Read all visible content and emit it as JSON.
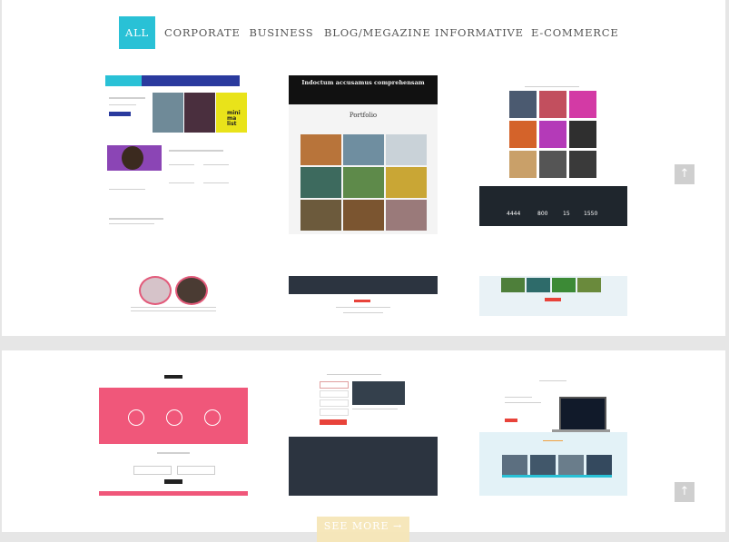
{
  "filters": [
    {
      "label": "ALL",
      "active": true
    },
    {
      "label": "CORPORATE",
      "active": false
    },
    {
      "label": "BUSINESS",
      "active": false
    },
    {
      "label": "BLOG/MEGAZINE",
      "active": false
    },
    {
      "label": "INFORMATIVE",
      "active": false
    },
    {
      "label": "E-COMMERCE",
      "active": false
    }
  ],
  "thumb2": {
    "hero_title": "Indoctum accusamus comprehensam",
    "section_title": "Portfolio"
  },
  "thumb1": {
    "tile_text": "mini ma list"
  },
  "thumb3": {
    "stats": [
      "4444",
      "800",
      "15",
      "1550"
    ]
  },
  "scroll_top_icon": "arrow-up-icon",
  "load_more_label": "SEE MORE",
  "load_more_icon": "arrow-right-icon",
  "colors": {
    "accent": "#29c1d6",
    "pink": "#f0577a",
    "navy": "#2c3440"
  }
}
